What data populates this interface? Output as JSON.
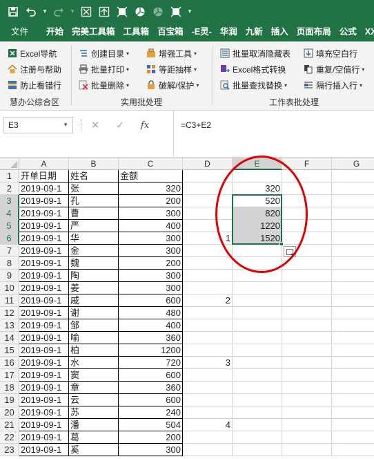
{
  "quick_access": {
    "icons": [
      "save-icon",
      "undo-icon",
      "redo-icon",
      "tool-icons"
    ]
  },
  "menu_tabs": [
    "文件",
    "开始",
    "完美工具箱",
    "工具箱",
    "百宝箱",
    "-E灵-",
    "华润",
    "九新",
    "插入",
    "页面布局",
    "公式",
    "XX"
  ],
  "ribbon": {
    "groups": [
      {
        "label": "慧办公综合区",
        "items": [
          {
            "label": "Excel导航",
            "icon": "excel-nav-icon",
            "dropdown": false
          },
          {
            "label": "注册与帮助",
            "icon": "home-icon",
            "dropdown": false
          },
          {
            "label": "防止看错行",
            "icon": "row-highlight-icon",
            "dropdown": false
          }
        ]
      },
      {
        "label": "实用批处理",
        "items": [
          {
            "label": "创建目录",
            "icon": "list-icon",
            "dropdown": true
          },
          {
            "label": "批量打印",
            "icon": "print-icon",
            "dropdown": true
          },
          {
            "label": "批量删除",
            "icon": "delete-icon",
            "dropdown": true
          },
          {
            "label": "增强工具",
            "icon": "tools-icon",
            "dropdown": true
          },
          {
            "label": "等距抽样",
            "icon": "sample-icon",
            "dropdown": true
          },
          {
            "label": "破解/保护",
            "icon": "lock-icon",
            "dropdown": true
          }
        ]
      },
      {
        "label": "工作表批处理",
        "items": [
          {
            "label": "批量取消隐藏表",
            "icon": "unhide-icon",
            "dropdown": false
          },
          {
            "label": "Excel格式转换",
            "icon": "convert-icon",
            "dropdown": false
          },
          {
            "label": "批量查找替换",
            "icon": "find-replace-icon",
            "dropdown": true
          },
          {
            "label": "填充空白行",
            "icon": "fill-icon",
            "dropdown": false
          },
          {
            "label": "重复/空值行",
            "icon": "duplicate-icon",
            "dropdown": true
          },
          {
            "label": "隔行插入行",
            "icon": "insert-row-icon",
            "dropdown": true
          }
        ]
      }
    ]
  },
  "formula_bar": {
    "name_box": "E3",
    "cancel": "✕",
    "enter": "✓",
    "fx": "fx",
    "formula": "=C3+E2"
  },
  "sheet": {
    "columns": [
      "A",
      "B",
      "C",
      "D",
      "E",
      "F",
      "G"
    ],
    "selected_column": "E",
    "selected_rows": [
      3,
      4,
      5,
      6
    ],
    "rows": [
      {
        "n": "1",
        "A": "开单日期",
        "B": "姓名",
        "C": "金额",
        "D": "",
        "E": ""
      },
      {
        "n": "2",
        "A": "2019-09-1",
        "B": "张",
        "C": "320",
        "D": "",
        "E": "320"
      },
      {
        "n": "3",
        "A": "2019-09-1",
        "B": "孔",
        "C": "200",
        "D": "",
        "E": "520"
      },
      {
        "n": "4",
        "A": "2019-09-1",
        "B": "曹",
        "C": "300",
        "D": "",
        "E": "820"
      },
      {
        "n": "5",
        "A": "2019-09-1",
        "B": "严",
        "C": "400",
        "D": "",
        "E": "1220"
      },
      {
        "n": "6",
        "A": "2019-09-1",
        "B": "华",
        "C": "300",
        "D": "1",
        "E": "1520"
      },
      {
        "n": "7",
        "A": "2019-09-1",
        "B": "金",
        "C": "300",
        "D": "",
        "E": ""
      },
      {
        "n": "8",
        "A": "2019-09-1",
        "B": "魏",
        "C": "200",
        "D": "",
        "E": ""
      },
      {
        "n": "9",
        "A": "2019-09-1",
        "B": "陶",
        "C": "300",
        "D": "",
        "E": ""
      },
      {
        "n": "10",
        "A": "2019-09-1",
        "B": "姜",
        "C": "300",
        "D": "",
        "E": ""
      },
      {
        "n": "11",
        "A": "2019-09-1",
        "B": "戚",
        "C": "600",
        "D": "2",
        "E": ""
      },
      {
        "n": "12",
        "A": "2019-09-1",
        "B": "谢",
        "C": "480",
        "D": "",
        "E": ""
      },
      {
        "n": "13",
        "A": "2019-09-1",
        "B": "邹",
        "C": "400",
        "D": "",
        "E": ""
      },
      {
        "n": "14",
        "A": "2019-09-1",
        "B": "喻",
        "C": "360",
        "D": "",
        "E": ""
      },
      {
        "n": "15",
        "A": "2019-09-1",
        "B": "柏",
        "C": "1200",
        "D": "",
        "E": ""
      },
      {
        "n": "16",
        "A": "2019-09-1",
        "B": "水",
        "C": "720",
        "D": "3",
        "E": ""
      },
      {
        "n": "17",
        "A": "2019-09-1",
        "B": "窦",
        "C": "600",
        "D": "",
        "E": ""
      },
      {
        "n": "18",
        "A": "2019-09-1",
        "B": "章",
        "C": "360",
        "D": "",
        "E": ""
      },
      {
        "n": "19",
        "A": "2019-09-1",
        "B": "云",
        "C": "600",
        "D": "",
        "E": ""
      },
      {
        "n": "20",
        "A": "2019-09-1",
        "B": "苏",
        "C": "240",
        "D": "",
        "E": ""
      },
      {
        "n": "21",
        "A": "2019-09-1",
        "B": "潘",
        "C": "504",
        "D": "4",
        "E": ""
      },
      {
        "n": "22",
        "A": "2019-09-1",
        "B": "葛",
        "C": "200",
        "D": "",
        "E": ""
      },
      {
        "n": "23",
        "A": "2019-09-1",
        "B": "奚",
        "C": "300",
        "D": "",
        "E": ""
      }
    ]
  },
  "colors": {
    "excel_green": "#217346",
    "annotation_red": "#e00000",
    "selection_gray": "#d3d3d3"
  }
}
